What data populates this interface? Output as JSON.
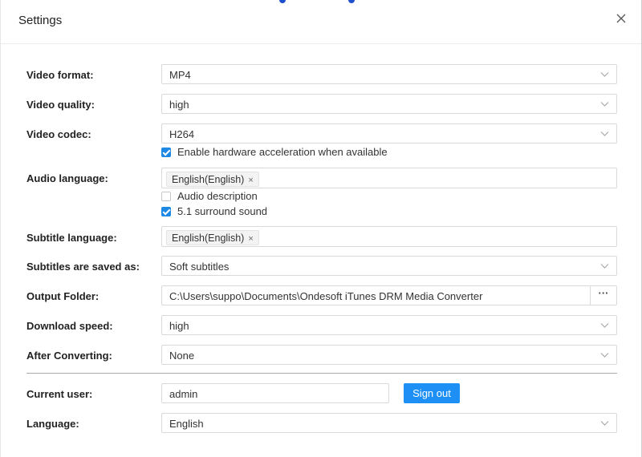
{
  "dialog": {
    "title": "Settings"
  },
  "fields": {
    "video_format": {
      "label": "Video format:",
      "value": "MP4"
    },
    "video_quality": {
      "label": "Video quality:",
      "value": "high"
    },
    "video_codec": {
      "label": "Video codec:",
      "value": "H264"
    },
    "hw_accel": {
      "label": "Enable hardware acceleration when available",
      "checked": true
    },
    "audio_language": {
      "label": "Audio language:",
      "tag": "English(English)"
    },
    "audio_description": {
      "label": "Audio description",
      "checked": false
    },
    "surround_sound": {
      "label": "5.1 surround sound",
      "checked": true
    },
    "subtitle_language": {
      "label": "Subtitle language:",
      "tag": "English(English)"
    },
    "subtitles_saved_as": {
      "label": "Subtitles are saved as:",
      "value": "Soft subtitles"
    },
    "output_folder": {
      "label": "Output Folder:",
      "value": "C:\\Users\\suppo\\Documents\\Ondesoft iTunes DRM Media Converter",
      "browse": "···"
    },
    "download_speed": {
      "label": "Download speed:",
      "value": "high"
    },
    "after_converting": {
      "label": "After Converting:",
      "value": "None"
    },
    "current_user": {
      "label": "Current user:",
      "value": "admin",
      "button": "Sign out"
    },
    "language": {
      "label": "Language:",
      "value": "English"
    }
  },
  "tag_remove_glyph": "×",
  "icons": {
    "close": "close-icon",
    "dropdown": "chevron-down-icon"
  },
  "colors": {
    "accent": "#1e88e5",
    "button": "#1e90f5"
  }
}
